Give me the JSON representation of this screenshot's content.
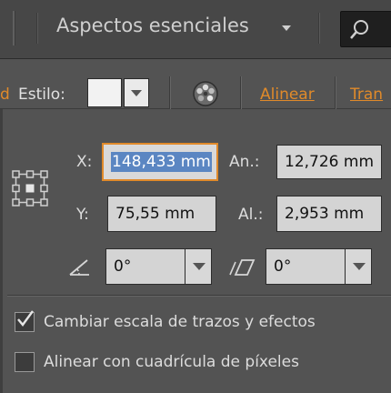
{
  "workspace": {
    "name": "Aspectos esenciales",
    "search_icon": "search-icon"
  },
  "control_bar": {
    "cut_letter": "d",
    "style_label": "Estilo:",
    "recolor_icon": "recolor-artwork-icon",
    "align_link": "Alinear",
    "transform_link": "Tran"
  },
  "transform": {
    "x_label": "X:",
    "x_value": "148,433 mm",
    "y_label": "Y:",
    "y_value": "75,55 mm",
    "width_label": "An.:",
    "width_value": "12,726 mm",
    "height_label": "Al.:",
    "height_value": "2,953 mm",
    "rotate_value": "0°",
    "shear_value": "0°"
  },
  "options": {
    "scale_strokes": {
      "label": "Cambiar escala de trazos y efectos",
      "checked": true
    },
    "pixel_grid": {
      "label": "Alinear con cuadrícula de píxeles",
      "checked": false
    }
  },
  "colors": {
    "accent": "#e08a2a",
    "selection": "#5b86c2",
    "panel": "#535353"
  }
}
